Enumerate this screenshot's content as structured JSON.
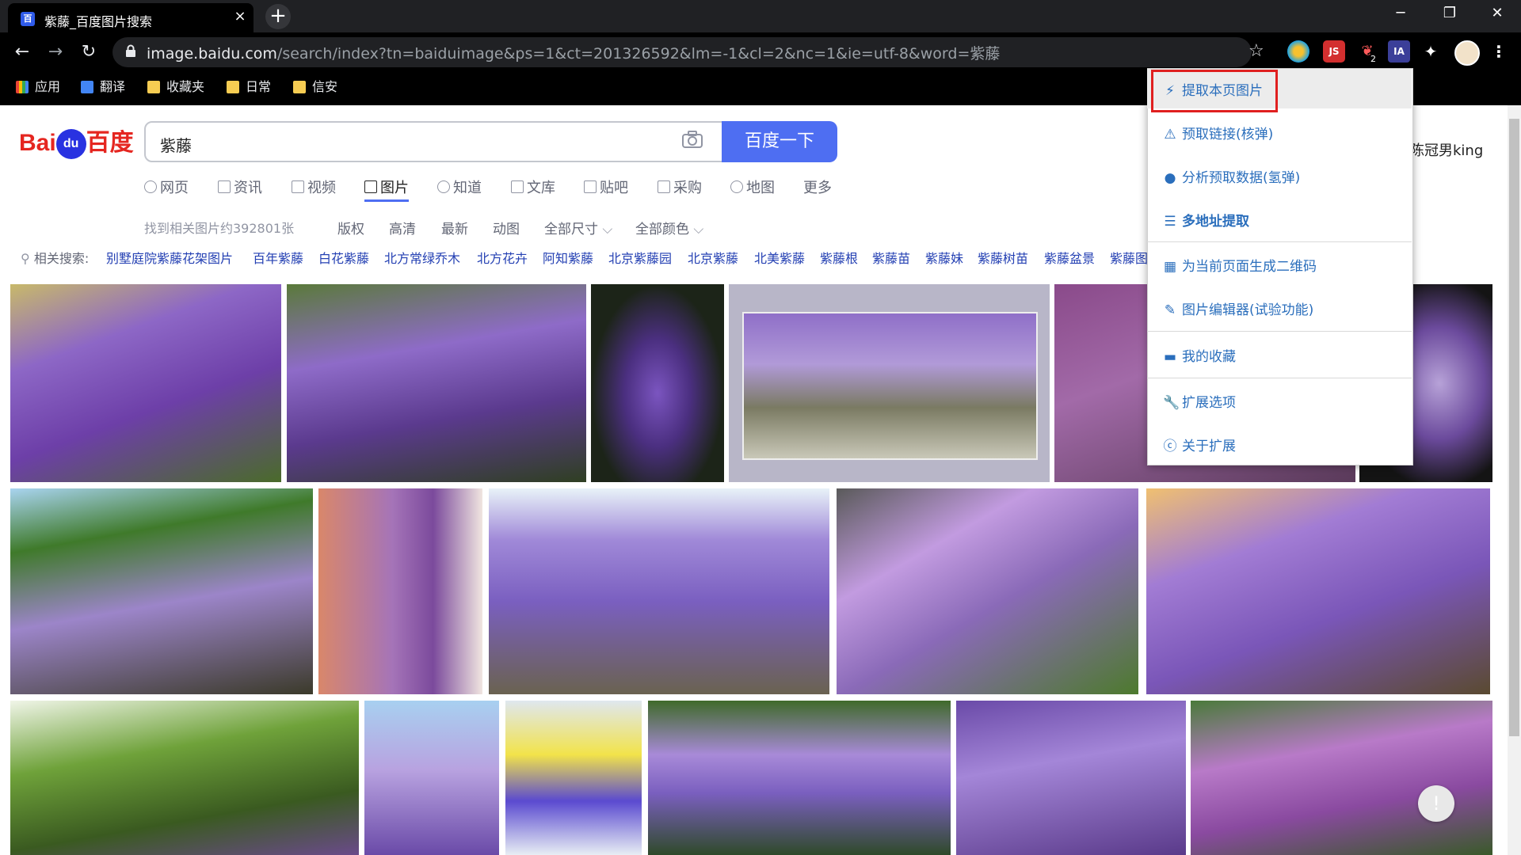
{
  "browser": {
    "tab_title": "紫藤_百度图片搜索",
    "tab_close": "×",
    "new_tab": "+",
    "url_host": "image.baidu.com",
    "url_path": "/search/index?tn=baiduimage&ps=1&ct=201326592&lm=-1&cl=2&nc=1&ie=utf-8&word=紫藤",
    "ext_js_label": "JS",
    "ext_ia_label": "IA",
    "ext_badge": "2",
    "window_minimize": "─",
    "window_restore": "❐",
    "window_close": "✕",
    "back": "←",
    "forward": "→",
    "reload": "↻",
    "bookmarks": [
      "应用",
      "翻译",
      "收藏夹",
      "日常",
      "信安"
    ]
  },
  "search": {
    "logo_text_left": "Bai",
    "logo_paw": "du",
    "logo_text_right": "百度",
    "query": "紫藤",
    "button": "百度一下"
  },
  "nav_tabs": [
    "网页",
    "资讯",
    "视频",
    "图片",
    "知道",
    "文库",
    "贴吧",
    "采购",
    "地图",
    "更多"
  ],
  "result_info": {
    "found": "找到相关图片约392801张",
    "filters": [
      "版权",
      "高清",
      "最新",
      "动图",
      "全部尺寸",
      "全部颜色"
    ]
  },
  "related": {
    "label": "相关搜索:",
    "items": [
      "别墅庭院紫藤花架图片",
      "百年紫藤",
      "白花紫藤",
      "北方常绿乔木",
      "北方花卉",
      "阿知紫藤",
      "北京紫藤园",
      "北京紫藤",
      "北美紫藤",
      "紫藤根",
      "紫藤苗",
      "紫藤妹",
      "紫藤树苗",
      "紫藤盆景",
      "紫藤图"
    ]
  },
  "user": {
    "name": "陈冠男king"
  },
  "extension_menu": {
    "items": [
      {
        "icon": "lightning-icon",
        "glyph": "⚡",
        "label": "提取本页图片"
      },
      {
        "icon": "warning-icon",
        "glyph": "⚠",
        "label": "预取链接(核弹)"
      },
      {
        "icon": "bomb-icon",
        "glyph": "●",
        "label": "分析预取数据(氢弹)"
      },
      {
        "icon": "list-icon",
        "glyph": "☰",
        "label": "多地址提取"
      },
      {
        "icon": "qrcode-icon",
        "glyph": "▦",
        "label": "为当前页面生成二维码"
      },
      {
        "icon": "edit-icon",
        "glyph": "✎",
        "label": "图片编辑器(试验功能)"
      },
      {
        "icon": "folder-icon",
        "glyph": "▬",
        "label": "我的收藏"
      },
      {
        "icon": "wrench-icon",
        "glyph": "🔧",
        "label": "扩展选项"
      },
      {
        "icon": "info-icon",
        "glyph": "ⓒ",
        "label": "关于扩展"
      }
    ]
  },
  "feedback_button": "!"
}
